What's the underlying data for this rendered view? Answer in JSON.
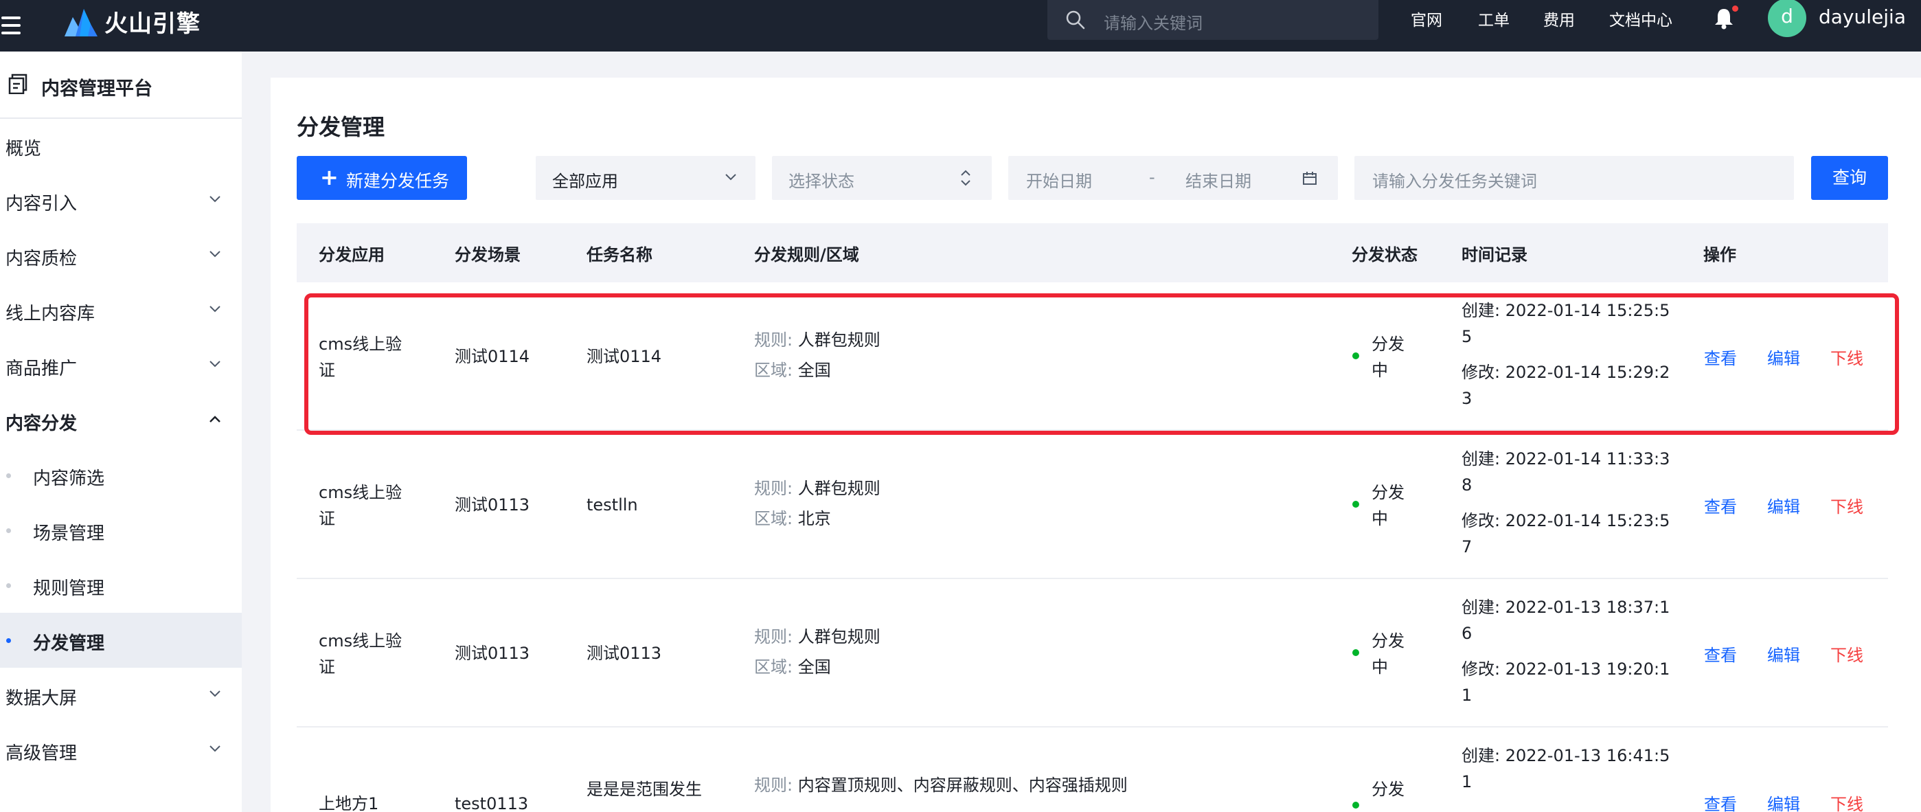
{
  "topbar": {
    "logo_text": "火山引擎",
    "search_placeholder": "请输入关键词",
    "nav_links": [
      "官网",
      "工单",
      "费用",
      "文档中心"
    ],
    "avatar_letter": "d",
    "username": "dayulejia"
  },
  "sidebar": {
    "title": "内容管理平台",
    "items": [
      {
        "label": "概览"
      },
      {
        "label": "内容引入"
      },
      {
        "label": "内容质检"
      },
      {
        "label": "线上内容库"
      },
      {
        "label": "商品推广"
      },
      {
        "label": "内容分发"
      },
      {
        "label": "内容筛选"
      },
      {
        "label": "场景管理"
      },
      {
        "label": "规则管理"
      },
      {
        "label": "分发管理"
      },
      {
        "label": "数据大屏"
      },
      {
        "label": "高级管理"
      }
    ]
  },
  "main": {
    "title": "分发管理",
    "new_button": "新建分发任务",
    "app_select": "全部应用",
    "status_placeholder": "选择状态",
    "start_date_placeholder": "开始日期",
    "date_separator": "-",
    "end_date_placeholder": "结束日期",
    "keyword_placeholder": "请输入分发任务关键词",
    "query_button": "查询"
  },
  "table": {
    "headers": [
      "分发应用",
      "分发场景",
      "任务名称",
      "分发规则/区域",
      "分发状态",
      "时间记录",
      "操作"
    ],
    "rule_prefix": "规则:",
    "region_prefix": "区域:",
    "actions": {
      "view": "查看",
      "edit": "编辑",
      "offline": "下线"
    },
    "rows": [
      {
        "app_l1": "cms线上验",
        "app_l2": "证",
        "scene": "测试0114",
        "task": "测试0114",
        "rule": "人群包规则",
        "region": "全国",
        "status_l1": "分发",
        "status_l2": "中",
        "created_l1": "创建: 2022-01-14 15:25:5",
        "created_l2": "5",
        "modified_l1": "修改: 2022-01-14 15:29:2",
        "modified_l2": "3"
      },
      {
        "app_l1": "cms线上验",
        "app_l2": "证",
        "scene": "测试0113",
        "task": "testlln",
        "rule": "人群包规则",
        "region": "北京",
        "status_l1": "分发",
        "status_l2": "中",
        "created_l1": "创建: 2022-01-14 11:33:3",
        "created_l2": "8",
        "modified_l1": "修改: 2022-01-14 15:23:5",
        "modified_l2": "7"
      },
      {
        "app_l1": "cms线上验",
        "app_l2": "证",
        "scene": "测试0113",
        "task": "测试0113",
        "rule": "人群包规则",
        "region": "全国",
        "status_l1": "分发",
        "status_l2": "中",
        "created_l1": "创建: 2022-01-13 18:37:1",
        "created_l2": "6",
        "modified_l1": "修改: 2022-01-13 19:20:1",
        "modified_l2": "1"
      },
      {
        "app_l1": "上地方1",
        "app_l2": "",
        "scene": "test0113",
        "task": "是是是范围发生",
        "rule": "内容置顶规则、内容屏蔽规则、内容强插规则",
        "region": "",
        "status_l1": "分发",
        "status_l2": "",
        "created_l1": "创建: 2022-01-13 16:41:5",
        "created_l2": "1",
        "modified_l1": "",
        "modified_l2": ""
      }
    ]
  },
  "colors": {
    "topbar_bg": "#1c2330",
    "primary": "#1664ff",
    "danger": "#f53f3f",
    "status_green": "#00b42a",
    "highlight_border": "#ee2434"
  }
}
